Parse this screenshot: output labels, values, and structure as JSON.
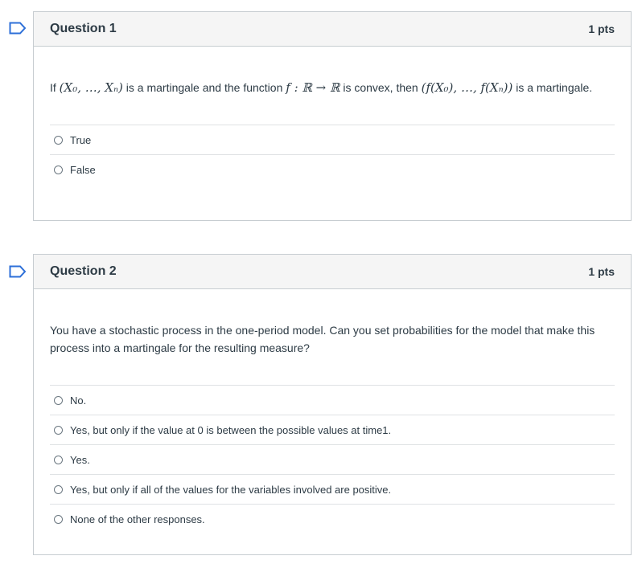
{
  "questions": [
    {
      "title": "Question 1",
      "points": "1 pts",
      "text_before": "If ",
      "math1": "(X₀, …, Xₙ)",
      "text_mid": " is a martingale and the function ",
      "math2": "f : ℝ → ℝ",
      "text_mid2": " is convex, then ",
      "math3": "(f(X₀), …, f(Xₙ))",
      "text_after": " is a martingale.",
      "answers": [
        "True",
        "False"
      ]
    },
    {
      "title": "Question 2",
      "points": "1 pts",
      "text": "You have a stochastic process in the one-period model.  Can you set probabilities for the model that make this process into a martingale for the resulting measure?",
      "answers": [
        "No.",
        "Yes, but only if the value at 0 is between the possible values at time1.",
        "Yes.",
        "Yes, but only if all of the values for the variables involved are positive.",
        "None of the other responses."
      ]
    }
  ],
  "colors": {
    "flag": "#2d6fd8",
    "header_bg": "#f5f5f5",
    "border": "#c7cdd1"
  },
  "icons": {
    "flag": "bookmark-flag-icon"
  }
}
